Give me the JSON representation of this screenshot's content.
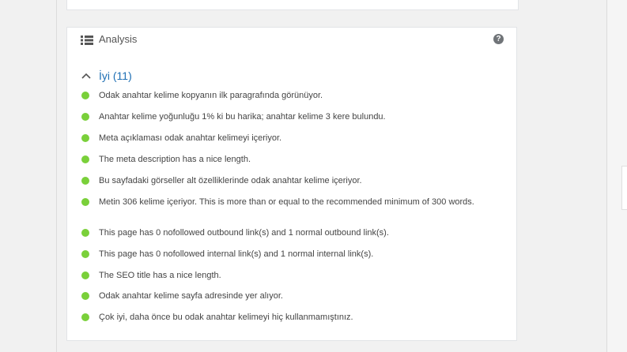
{
  "panel": {
    "title": "Analysis",
    "help_icon": "question-circle-icon",
    "list_icon": "list-icon"
  },
  "section": {
    "label": "İyi (11)",
    "status_color": "#7ad03a",
    "label_color": "#1e6fb4",
    "items": [
      "Odak anahtar kelime kopyanın ilk paragrafında görünüyor.",
      "Anahtar kelime yoğunluğu 1% ki bu harika; anahtar kelime 3 kere bulundu.",
      "Meta açıklaması odak anahtar kelimeyi içeriyor.",
      "The meta description has a nice length.",
      "Bu sayfadaki görseller alt özelliklerinde odak anahtar kelime içeriyor.",
      "Metin 306 kelime içeriyor. This is more than or equal to the recommended minimum of 300 words.",
      "This page has 0 nofollowed outbound link(s) and 1 normal outbound link(s).",
      "This page has 0 nofollowed internal link(s) and 1 normal internal link(s).",
      "The SEO title has a nice length.",
      "Odak anahtar kelime sayfa adresinde yer alıyor.",
      "Çok iyi, daha önce bu odak anahtar kelimeyi hiç kullanmamıştınız."
    ]
  }
}
